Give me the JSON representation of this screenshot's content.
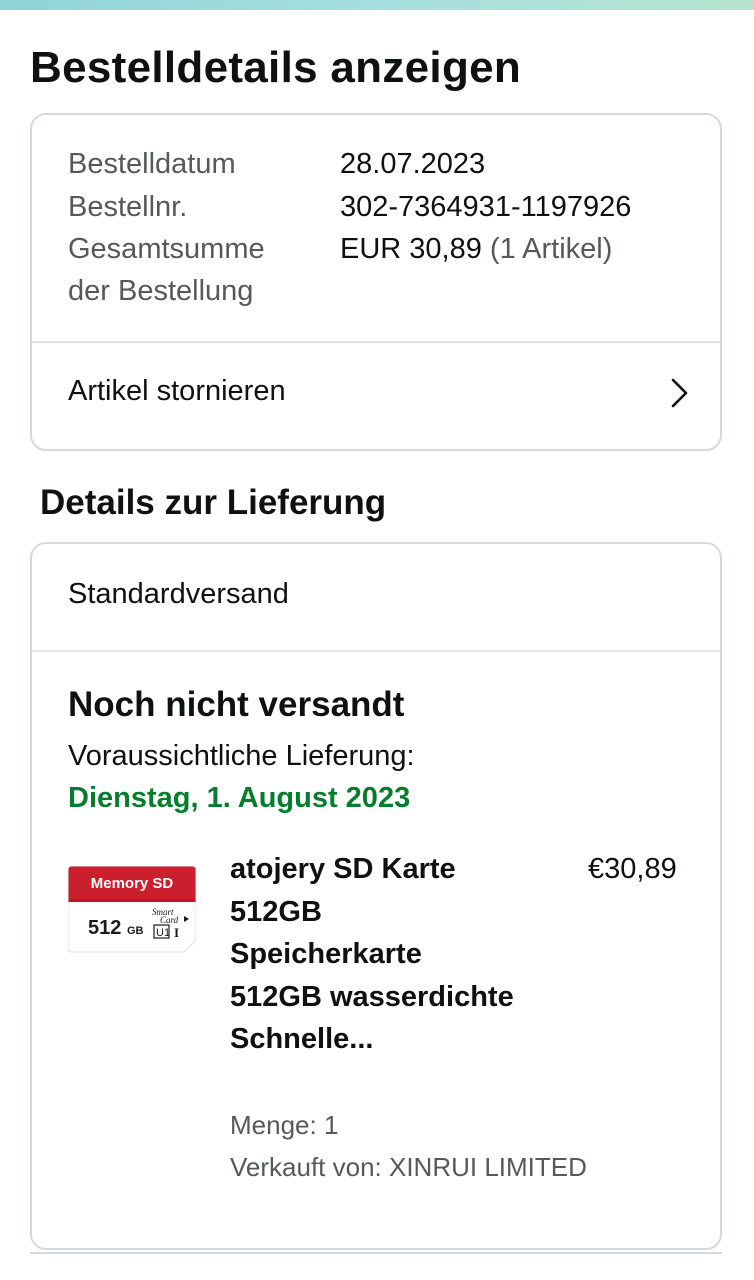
{
  "page": {
    "title": "Bestelldetails anzeigen"
  },
  "order_summary": {
    "date_label": "Bestelldatum",
    "date_value": "28.07.2023",
    "number_label": "Bestellnr.",
    "number_value": "302-7364931-1197926",
    "total_label": "Gesamtsumme der Bestellung",
    "total_value": "EUR 30,89",
    "total_items": "(1 Artikel)"
  },
  "actions": {
    "cancel_label": "Artikel stornieren",
    "cancel_icon": "chevron-right-icon"
  },
  "delivery": {
    "section_title": "Details zur Lieferung",
    "method": "Standardversand",
    "status": "Noch nicht versandt",
    "eta_label": "Voraussichtliche Lieferung:",
    "eta_date": "Dienstag, 1. August 2023"
  },
  "product": {
    "title": "atojery SD Karte 512GB Speicherkarte 512GB wasserdichte Schnelle...",
    "price": "€30,89",
    "quantity": "Menge: 1",
    "seller": "Verkauft von: XINRUI LIMITED",
    "image_text": {
      "brand": "Memory SD",
      "capacity": "512",
      "unit": "GB",
      "line1": "Smart",
      "line2": "Card",
      "class": "U1",
      "speed": "I"
    }
  },
  "colors": {
    "eta_green": "#067d2c",
    "border": "#d5d9d9",
    "muted_text": "#565959",
    "card_red": "#cc1f2d"
  }
}
